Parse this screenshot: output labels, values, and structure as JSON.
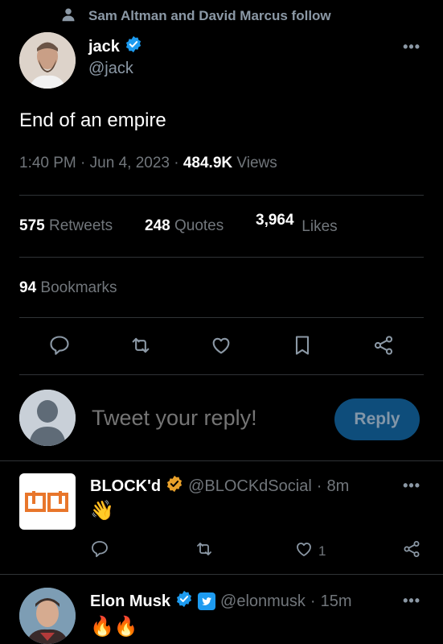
{
  "social_context": {
    "text": "Sam Altman and David Marcus follow"
  },
  "tweet": {
    "author_name": "jack",
    "author_handle": "@jack",
    "more": "•••",
    "text": "End of an empire",
    "time": "1:40 PM",
    "date": "Jun 4, 2023",
    "views_count": "484.9K",
    "views_label": "Views"
  },
  "stats": {
    "retweets_count": "575",
    "retweets_label": "Retweets",
    "quotes_count": "248",
    "quotes_label": "Quotes",
    "likes_count": "3,964",
    "likes_label": "Likes",
    "bookmarks_count": "94",
    "bookmarks_label": "Bookmarks"
  },
  "reply_box": {
    "placeholder": "Tweet your reply!",
    "button_label": "Reply"
  },
  "replies": [
    {
      "name": "BLOCK'd",
      "handle": "@BLOCKdSocial",
      "time": "8m",
      "text": "👋",
      "like_count": "1",
      "more": "•••",
      "verified_color": "#e8a02a",
      "avatar_text": "bd"
    },
    {
      "name": "Elon Musk",
      "handle": "@elonmusk",
      "time": "15m",
      "text": "🔥🔥",
      "more": "•••",
      "verified_color": "#1d9bf0"
    }
  ],
  "colors": {
    "accent": "#1d9bf0",
    "muted": "#71767b",
    "background": "#000000"
  }
}
